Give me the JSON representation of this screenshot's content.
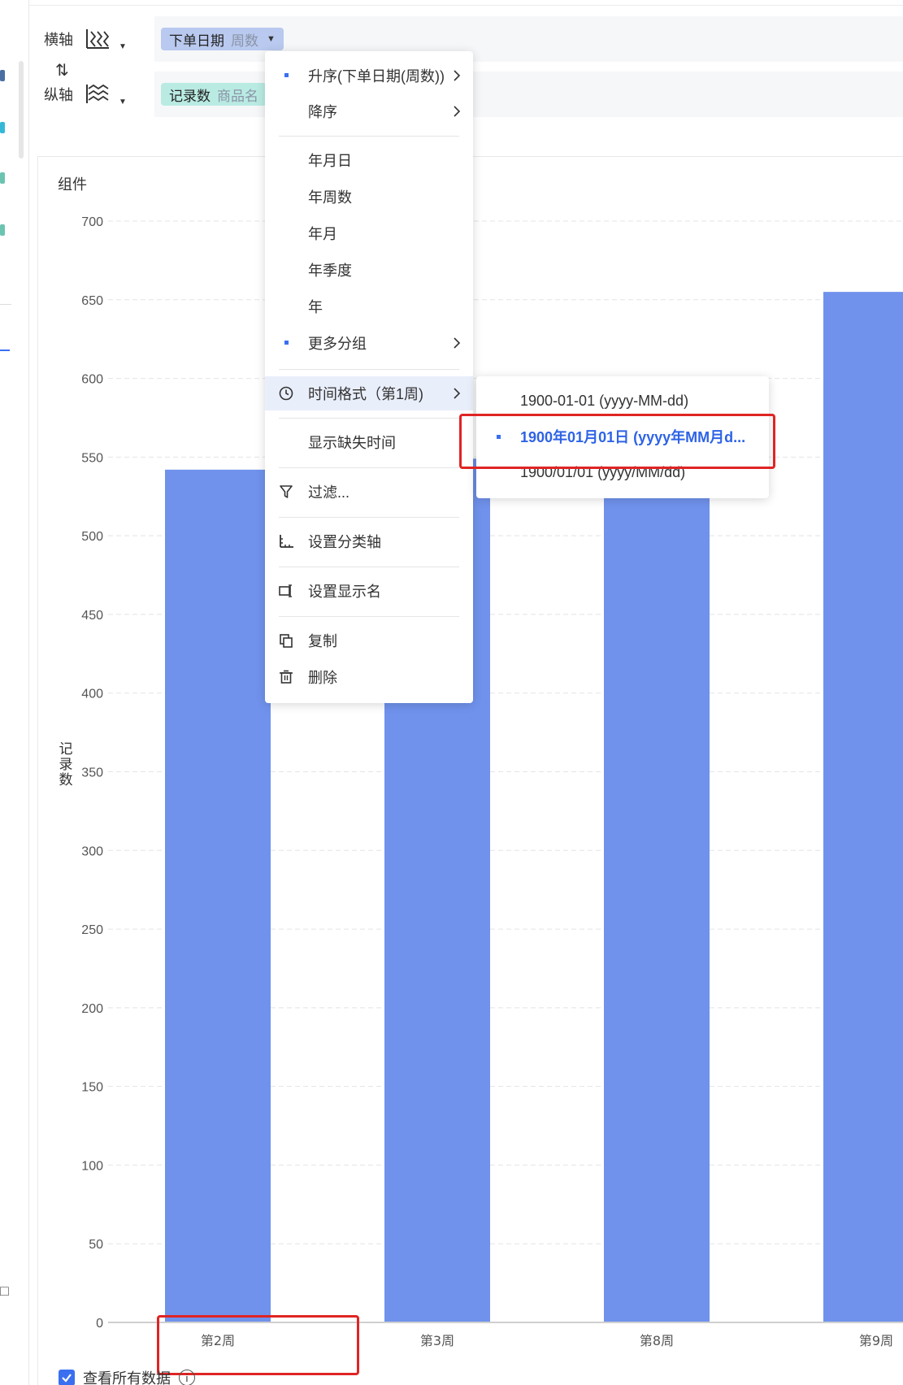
{
  "axis_bar": {
    "x_axis": {
      "label": "横轴",
      "field": "下单日期",
      "field_sub": "周数"
    },
    "y_axis": {
      "label": "纵轴",
      "field": "记录数",
      "field_sub": "商品名"
    }
  },
  "panel": {
    "title": "组件"
  },
  "context_menu": {
    "items": [
      {
        "label": "升序(下单日期(周数))"
      },
      {
        "label": "降序"
      },
      {
        "label": "年月日"
      },
      {
        "label": "年周数"
      },
      {
        "label": "年月"
      },
      {
        "label": "年季度"
      },
      {
        "label": "年"
      },
      {
        "label": "更多分组"
      },
      {
        "label": "时间格式（第1周)"
      },
      {
        "label": "显示缺失时间"
      },
      {
        "label": "过滤..."
      },
      {
        "label": "设置分类轴"
      },
      {
        "label": "设置显示名"
      },
      {
        "label": "复制"
      },
      {
        "label": "删除"
      }
    ]
  },
  "time_format_submenu": {
    "options": [
      {
        "label": "1900-01-01 (yyyy-MM-dd)"
      },
      {
        "label": "1900年01月01日 (yyyy年MM月d..."
      },
      {
        "label": "1900/01/01 (yyyy/MM/dd)"
      }
    ]
  },
  "colors": {
    "bar": "#7092ec",
    "accent": "#3a6ff0",
    "highlight_box": "#e02424"
  },
  "footer": {
    "view_all_data_label": "查看所有数据",
    "view_all_data_checked": true
  },
  "chart_data": {
    "type": "bar",
    "categories": [
      "第2周",
      "第3周",
      "第8周",
      "第9周"
    ],
    "values": [
      542,
      549,
      552,
      655
    ],
    "ylabel": "记录数",
    "xlabel": "",
    "ylim": [
      0,
      700
    ],
    "ticks": [
      0,
      50,
      100,
      150,
      200,
      250,
      300,
      350,
      400,
      450,
      500,
      550,
      600,
      650,
      700
    ],
    "grid": true
  }
}
